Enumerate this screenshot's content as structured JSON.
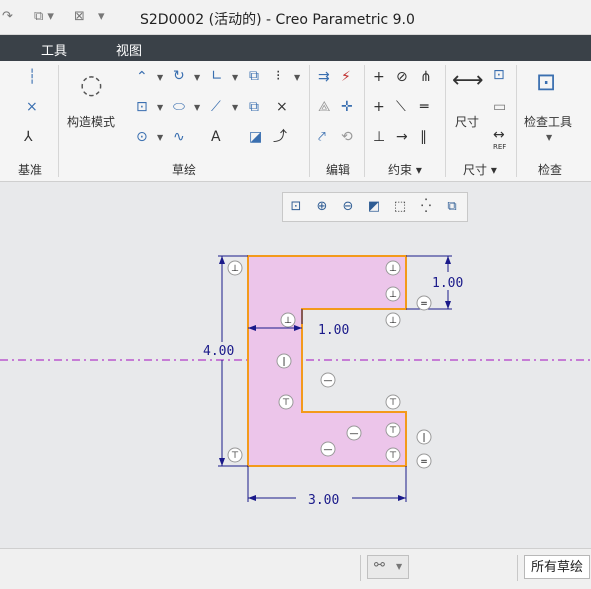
{
  "window": {
    "title": "S2D0002 (活动的) - Creo Parametric 9.0"
  },
  "menu": {
    "items": [
      "工具",
      "视图"
    ]
  },
  "ribbon": {
    "groups": [
      "基准",
      "草绘",
      "编辑",
      "约束",
      "尺寸",
      "检查"
    ],
    "construct_mode_label": "构造模式",
    "dimension_label": "尺寸",
    "inspect_tool_label": "检查工具",
    "constraint_dd": "约束 ▾",
    "dimension_dd": "尺寸 ▾",
    "ref_label": "REF"
  },
  "sketch": {
    "dims": {
      "height": "4.00",
      "width": "3.00",
      "top_height": "1.00",
      "notch_width": "1.00"
    },
    "colors": {
      "fill": "#ecc5ea",
      "outline": "#f39a1b",
      "centerline": "#b23cc8",
      "dim": "#1a1a8a"
    }
  },
  "status": {
    "filter_value": "所有草绘"
  }
}
